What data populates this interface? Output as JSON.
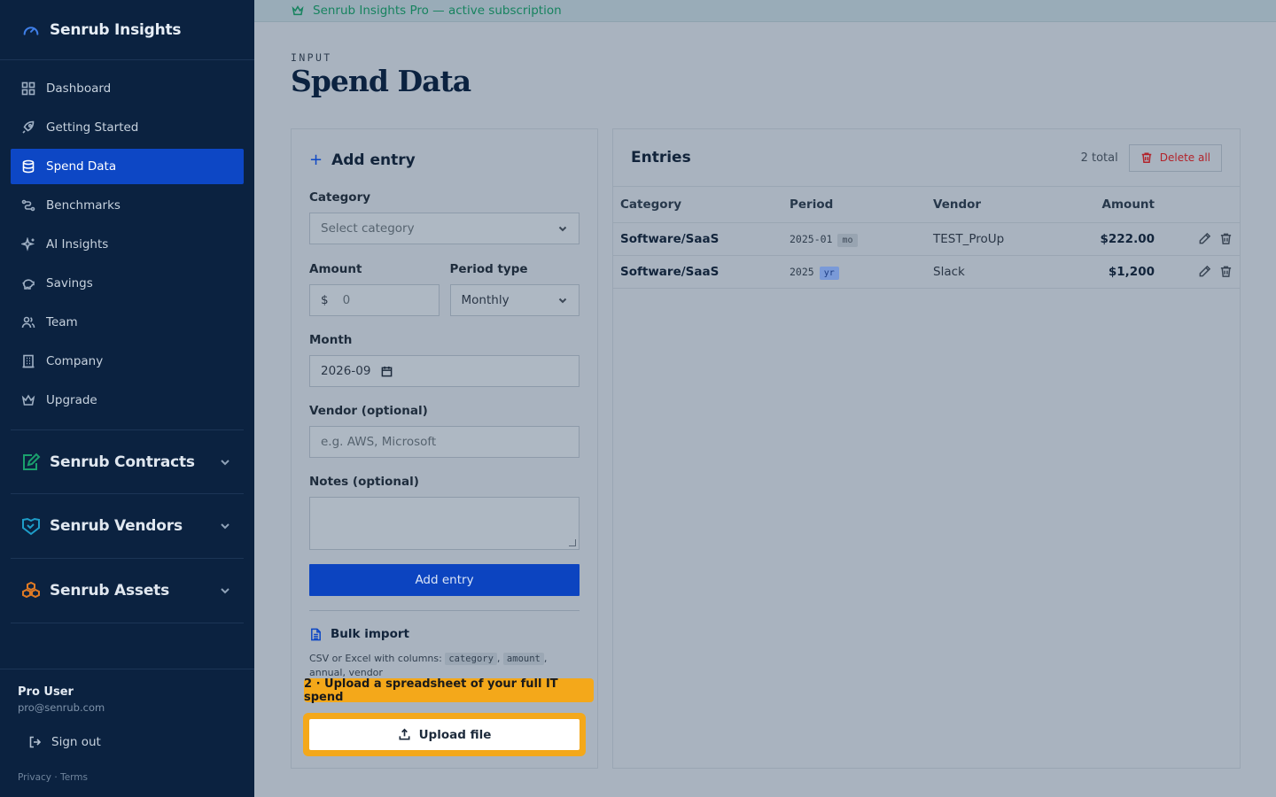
{
  "brand": {
    "name": "Senrub Insights"
  },
  "nav": [
    {
      "label": "Dashboard",
      "icon": "grid-icon"
    },
    {
      "label": "Getting Started",
      "icon": "rocket-icon"
    },
    {
      "label": "Spend Data",
      "icon": "database-icon",
      "active": true
    },
    {
      "label": "Benchmarks",
      "icon": "chart-icon"
    },
    {
      "label": "AI Insights",
      "icon": "sparkle-icon"
    },
    {
      "label": "Savings",
      "icon": "piggy-bank-icon"
    },
    {
      "label": "Team",
      "icon": "users-icon"
    },
    {
      "label": "Company",
      "icon": "building-icon"
    },
    {
      "label": "Upgrade",
      "icon": "crown-icon"
    }
  ],
  "products": [
    {
      "name": "Senrub Contracts",
      "icon": "contract-icon",
      "color": "#1aa06d"
    },
    {
      "name": "Senrub Vendors",
      "icon": "handshake-icon",
      "color": "#1e9dc8"
    },
    {
      "name": "Senrub Assets",
      "icon": "boxes-icon",
      "color": "#e07a24"
    }
  ],
  "user": {
    "name": "Pro User",
    "email": "pro@senrub.com",
    "signout": "Sign out",
    "privacy": "Privacy",
    "terms": "Terms"
  },
  "banner": {
    "text": "Senrub Insights Pro — active subscription"
  },
  "page": {
    "eyebrow": "INPUT",
    "title": "Spend Data"
  },
  "form": {
    "heading": "Add entry",
    "category_label": "Category",
    "category_placeholder": "Select category",
    "amount_label": "Amount",
    "amount_prefix": "$",
    "amount_placeholder": "0",
    "period_label": "Period type",
    "period_value": "Monthly",
    "month_label": "Month",
    "month_value": "2026-09",
    "vendor_label": "Vendor (optional)",
    "vendor_placeholder": "e.g. AWS, Microsoft",
    "notes_label": "Notes (optional)",
    "submit": "Add entry"
  },
  "bulk": {
    "heading": "Bulk import",
    "desc_prefix": "CSV or Excel with columns:",
    "col1": "category",
    "col2": "amount",
    "desc_line2": "annual, vendor",
    "upload": "Upload file"
  },
  "tooltip": {
    "text": "2 · Upload a spreadsheet of your full IT spend"
  },
  "entries": {
    "title": "Entries",
    "count": "2 total",
    "delete_all": "Delete all",
    "columns": {
      "category": "Category",
      "period": "Period",
      "vendor": "Vendor",
      "amount": "Amount"
    },
    "rows": [
      {
        "category": "Software/SaaS",
        "period": "2025-01",
        "tag": "mo",
        "vendor": "TEST_ProUp",
        "amount": "$222.00"
      },
      {
        "category": "Software/SaaS",
        "period": "2025",
        "tag": "yr",
        "vendor": "Slack",
        "amount": "$1,200"
      }
    ]
  },
  "colors": {
    "accent": "#0d47c5",
    "sidebar": "#0b2240",
    "highlight": "#f4a81a",
    "danger": "#b2232b",
    "success": "#17835f"
  }
}
